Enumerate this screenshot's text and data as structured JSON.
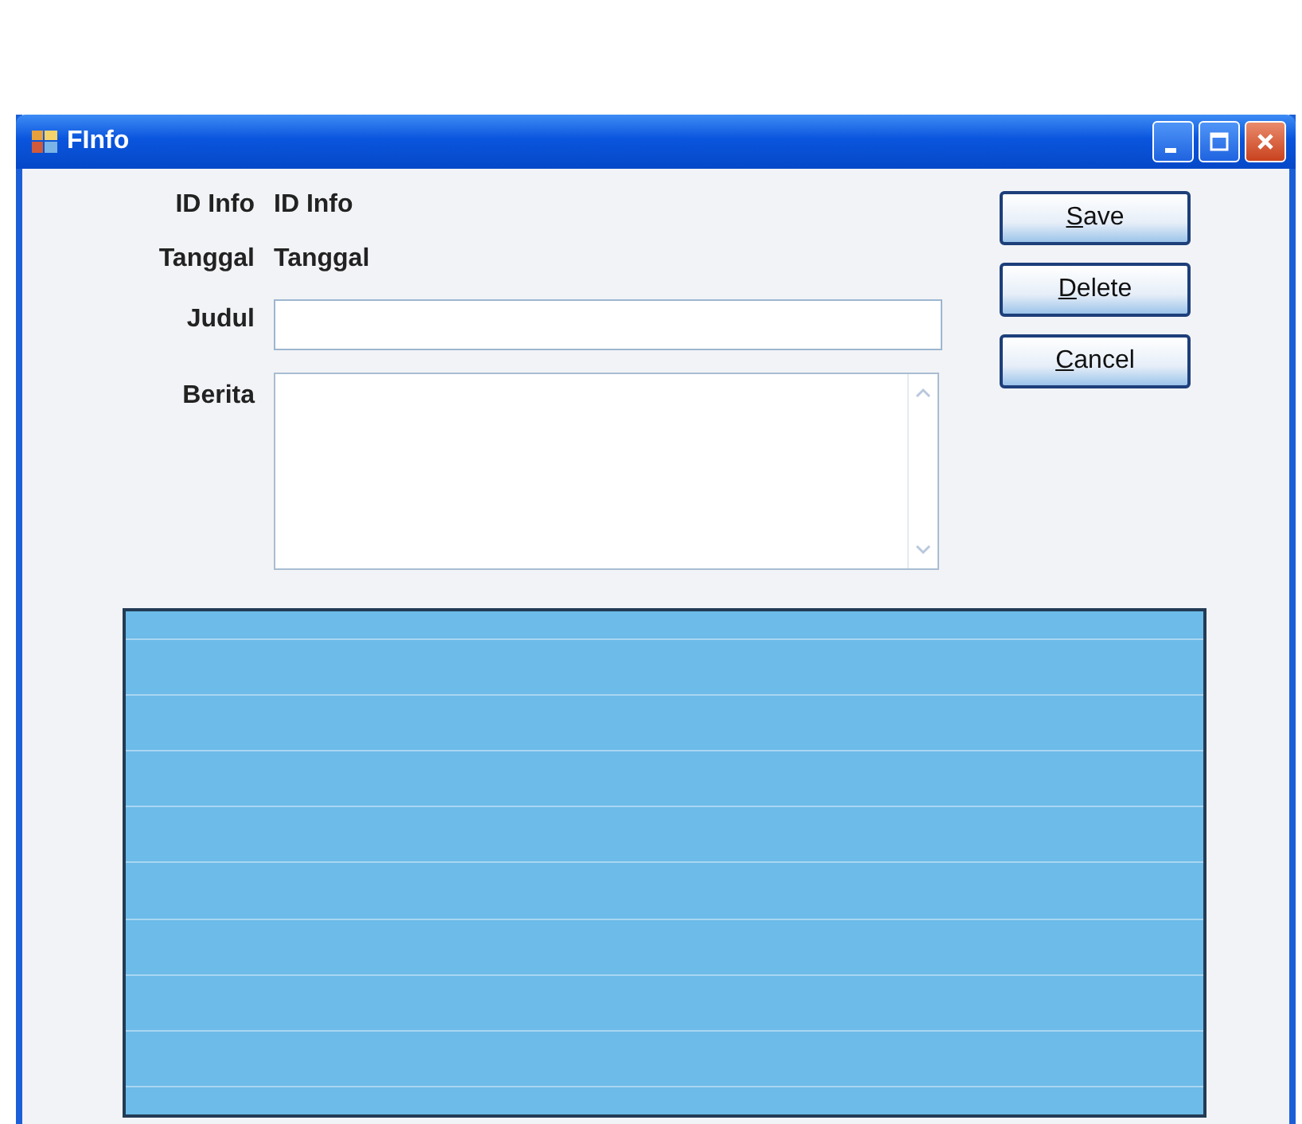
{
  "window": {
    "title": "FInfo"
  },
  "fields": [
    {
      "kind": "text",
      "label": "ID Info",
      "value": "ID Info"
    },
    {
      "kind": "text",
      "label": "Tanggal",
      "value": "Tanggal"
    },
    {
      "kind": "input",
      "label": "Judul"
    },
    {
      "kind": "textarea",
      "label": "Berita"
    }
  ],
  "buttons": [
    {
      "label": "Save",
      "access_key_underlined": true
    },
    {
      "label": "Delete",
      "access_key_underlined": true
    },
    {
      "label": "Cancel",
      "access_key_underlined": true
    }
  ]
}
